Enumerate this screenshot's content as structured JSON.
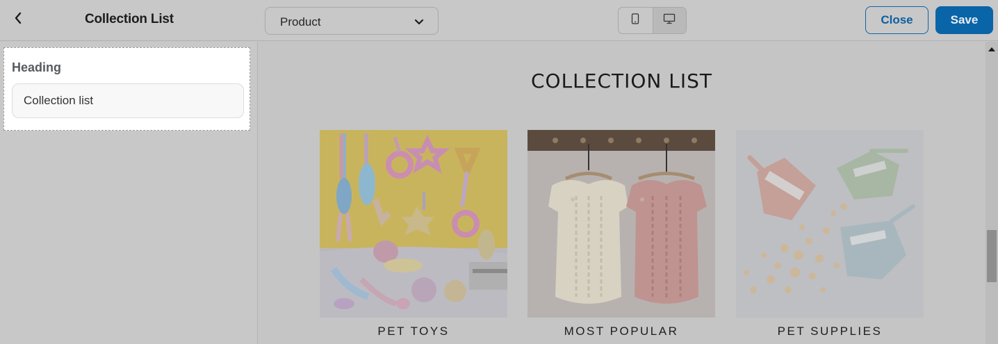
{
  "header": {
    "title": "Collection List",
    "page_select_value": "Product",
    "close_label": "Close",
    "save_label": "Save"
  },
  "settings": {
    "heading_label": "Heading",
    "heading_value": "Collection list"
  },
  "preview": {
    "section_title": "COLLECTION LIST",
    "collections": [
      {
        "caption": "PET TOYS"
      },
      {
        "caption": "MOST POPULAR"
      },
      {
        "caption": "PET SUPPLIES"
      }
    ]
  },
  "colors": {
    "accent": "#0a64a8",
    "overlay_gray": "#c5c5c5",
    "panel_white": "#ffffff"
  },
  "icons": [
    "chevron-left-icon",
    "chevron-down-icon",
    "mobile-icon",
    "desktop-icon"
  ]
}
